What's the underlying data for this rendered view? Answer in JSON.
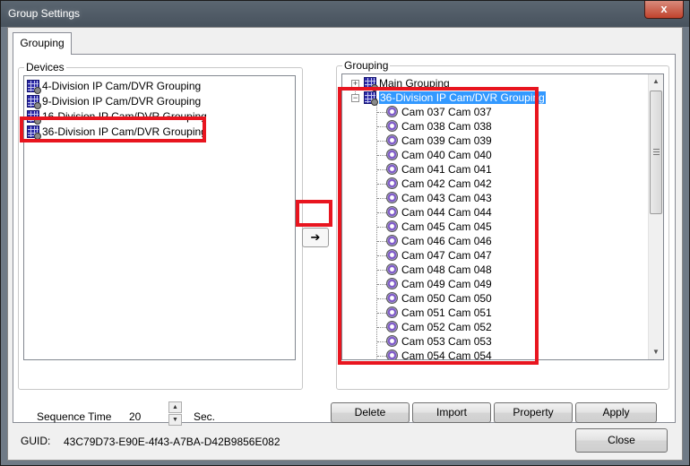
{
  "window": {
    "title": "Group Settings",
    "close_glyph": "x"
  },
  "tabs": [
    {
      "label": "Grouping"
    }
  ],
  "devices": {
    "label": "Devices",
    "items": [
      {
        "label": "4-Division IP Cam/DVR Grouping"
      },
      {
        "label": "9-Division IP Cam/DVR Grouping"
      },
      {
        "label": "16-Division IP Cam/DVR Grouping"
      },
      {
        "label": "36-Division IP Cam/DVR Grouping"
      }
    ]
  },
  "transfer": {
    "arrow_glyph": "➔"
  },
  "grouping": {
    "label": "Grouping",
    "root_items": [
      {
        "label": "Main Grouping",
        "expander": "+"
      },
      {
        "label": "36-Division IP Cam/DVR Grouping",
        "expander": "−",
        "selected": true
      }
    ],
    "cameras": [
      "Cam 037 Cam 037",
      "Cam 038 Cam 038",
      "Cam 039 Cam 039",
      "Cam 040 Cam 040",
      "Cam 041 Cam 041",
      "Cam 042 Cam 042",
      "Cam 043 Cam 043",
      "Cam 044 Cam 044",
      "Cam 045 Cam 045",
      "Cam 046 Cam 046",
      "Cam 047 Cam 047",
      "Cam 048 Cam 048",
      "Cam 049 Cam 049",
      "Cam 050 Cam 050",
      "Cam 051 Cam 051",
      "Cam 052 Cam 052",
      "Cam 053 Cam 053",
      "Cam 054 Cam 054"
    ]
  },
  "sequence": {
    "label": "Sequence Time",
    "value": "20",
    "unit": "Sec."
  },
  "actions": {
    "delete": "Delete",
    "import": "Import",
    "property": "Property",
    "apply": "Apply"
  },
  "footer": {
    "guid_label": "GUID:",
    "guid_value": "43C79D73-E90E-4f43-A7BA-D42B9856E082",
    "close_label": "Close"
  },
  "colors": {
    "highlight": "#e8151f",
    "selection": "#3399ff"
  }
}
